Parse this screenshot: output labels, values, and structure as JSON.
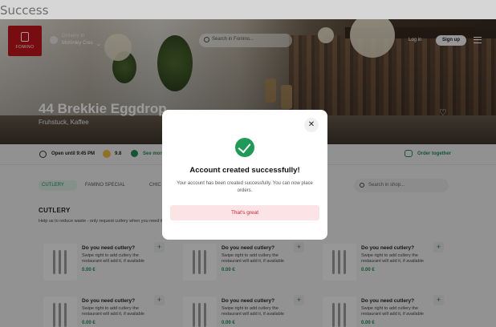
{
  "page": {
    "title": "Success"
  },
  "header": {
    "logo_text": "FOMINO",
    "delivery_label": "Delivery to",
    "delivery_value": "McKinley Cres",
    "search_placeholder": "Search in Fomino...",
    "login": "Log in",
    "signup": "Sign up"
  },
  "restaurant": {
    "name": "44 Brekkie Eggdrop",
    "subtitle": "Fruhstuck, Kaffee",
    "hours": "Open until 9:45 PM",
    "rating": "9.8",
    "see_more": "See more",
    "order_together": "Order together"
  },
  "categories": {
    "tabs": [
      "CUTLERY",
      "FAMINO SPECIAL",
      "CHIC"
    ],
    "search_placeholder": "Search in shop..."
  },
  "section": {
    "title": "CUTLERY",
    "note": "Help us to reduce waste - only request cutlery when you need it"
  },
  "products": [
    {
      "title": "Do you need cutlery?",
      "desc": "Swipe right to add cutlery the restaurant will add it, if available",
      "price": "0.00 €",
      "add": "+"
    },
    {
      "title": "Do you need cutlery?",
      "desc": "Swipe right to add cutlery the restaurant will add it, if available",
      "price": "0.00 €",
      "add": "+"
    },
    {
      "title": "Do you need cutlery?",
      "desc": "Swipe right to add cutlery the restaurant will add it, if available",
      "price": "0.00 €",
      "add": "+"
    },
    {
      "title": "Do you need cutlery?",
      "desc": "Swipe right to add cutlery the restaurant will add it, if available",
      "price": "0.00 €",
      "add": "+"
    },
    {
      "title": "Do you need cutlery?",
      "desc": "Swipe right to add cutlery the restaurant will add it, if available",
      "price": "0.00 €",
      "add": "+"
    },
    {
      "title": "Do you need cutlery?",
      "desc": "Swipe right to add cutlery the restaurant will add it, if available",
      "price": "0.00 €",
      "add": "+"
    }
  ],
  "modal": {
    "title": "Account created successfully!",
    "message": "Your account has been created successfully. You can now place orders.",
    "button": "That's great",
    "close": "✕"
  },
  "colors": {
    "brand": "#c0151c",
    "accent": "#1f8a56",
    "success": "#1f9a57",
    "danger_text": "#d21d2b"
  }
}
